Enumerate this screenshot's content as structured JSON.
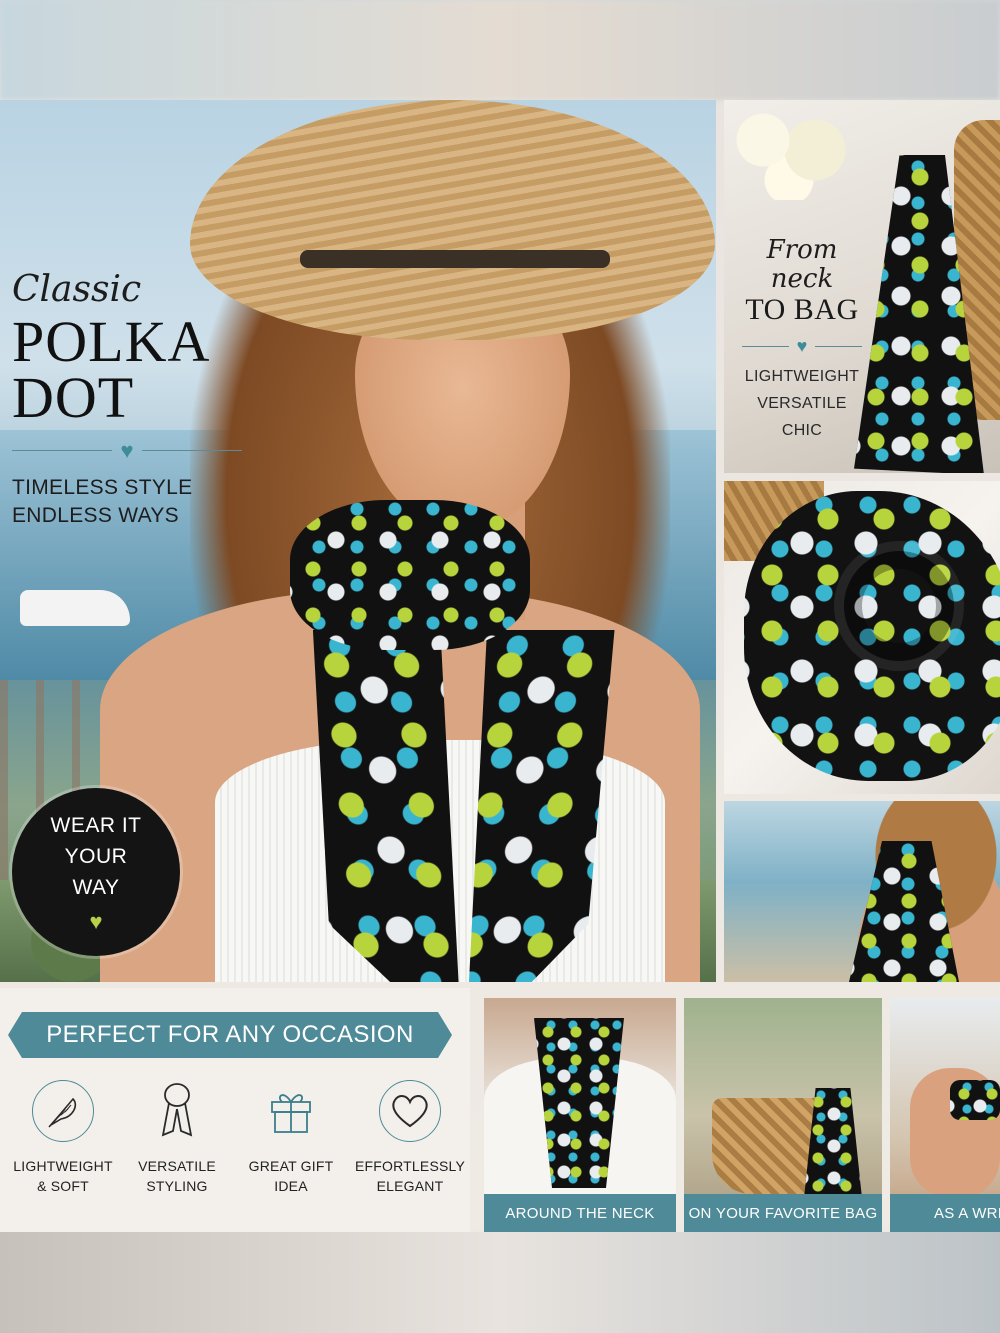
{
  "hero": {
    "script_title": "Classic",
    "title_line1": "POLKA",
    "title_line2": "DOT",
    "subtitle_line1": "TIMELESS STYLE",
    "subtitle_line2": "ENDLESS WAYS",
    "divider_icon": "heart-icon"
  },
  "badge": {
    "line1": "WEAR IT",
    "line2": "YOUR",
    "line3": "WAY",
    "icon": "heart-icon"
  },
  "bag_panel": {
    "script_title": "From neck",
    "title": "TO BAG",
    "divider_icon": "heart-icon",
    "features": [
      "LIGHTWEIGHT",
      "VERSATILE",
      "CHIC"
    ]
  },
  "occasion": {
    "banner": "PERFECT FOR ANY OCCASION",
    "features": [
      {
        "icon": "feather-icon",
        "line1": "LIGHTWEIGHT",
        "line2": "& SOFT"
      },
      {
        "icon": "scarf-icon",
        "line1": "VERSATILE",
        "line2": "STYLING"
      },
      {
        "icon": "gift-icon",
        "line1": "GREAT GIFT",
        "line2": "IDEA"
      },
      {
        "icon": "heart-icon",
        "line1": "EFFORTLESSLY",
        "line2": "ELEGANT"
      }
    ]
  },
  "thumbnails": [
    {
      "caption": "AROUND THE NECK"
    },
    {
      "caption": "ON YOUR FAVORITE BAG"
    },
    {
      "caption": "AS A WRI"
    }
  ],
  "colors": {
    "accent_teal": "#4e8a97",
    "dot_green": "#b8d43c",
    "dot_blue": "#3ab5cf",
    "dot_white": "#e8ecef",
    "scarf_black": "#111111"
  }
}
